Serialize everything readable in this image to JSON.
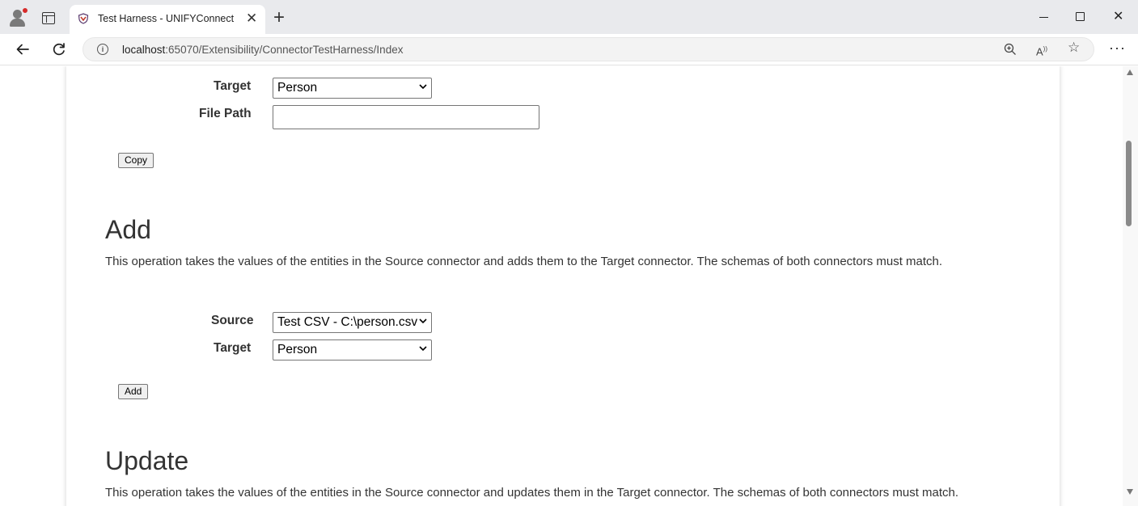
{
  "browser": {
    "tab_title": "Test Harness - UNIFYConnect",
    "url_host": "localhost",
    "url_path": ":65070/Extensibility/ConnectorTestHarness/Index"
  },
  "copy_section": {
    "target_label": "Target",
    "target_value": "Person",
    "file_path_label": "File Path",
    "file_path_value": "",
    "button_label": "Copy"
  },
  "add_section": {
    "heading": "Add",
    "description": "This operation takes the values of the entities in the Source connector and adds them to the Target connector. The schemas of both connectors must match.",
    "source_label": "Source",
    "source_value": "Test CSV - C:\\person.csv",
    "target_label": "Target",
    "target_value": "Person",
    "button_label": "Add"
  },
  "update_section": {
    "heading": "Update",
    "description": "This operation takes the values of the entities in the Source connector and updates them in the Target connector. The schemas of both connectors must match."
  }
}
